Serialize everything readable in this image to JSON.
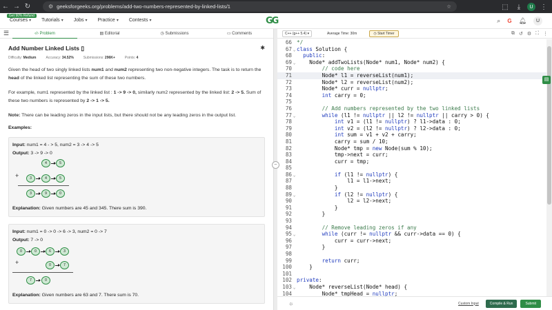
{
  "browser": {
    "url": "geeksforgeeks.org/problems/add-two-numbers-represented-by-linked-lists/1",
    "profile_initial": "U"
  },
  "header": {
    "badge": "Get 90% Refund",
    "nav": [
      "Courses",
      "Tutorials",
      "Jobs",
      "Practice",
      "Contests"
    ],
    "logo": "GG",
    "streak": "G",
    "user_initial": "U"
  },
  "left_tabs": [
    "Problem",
    "Editorial",
    "Submissions",
    "Comments"
  ],
  "problem": {
    "title": "Add Number Linked Lists",
    "difficulty_label": "Difficulty:",
    "difficulty": "Medium",
    "accuracy_label": "Accuracy:",
    "accuracy": "34.52%",
    "submissions_label": "Submissions:",
    "submissions": "296K+",
    "points_label": "Points:",
    "points": "4",
    "p1_a": "Given the head of two singly linked lists ",
    "p1_b": "num1",
    "p1_c": " and ",
    "p1_d": "num2",
    "p1_e": " representing two non-negative integers. The task is to return the ",
    "p1_f": "head",
    "p1_g": " of the linked list representing the sum of these two numbers.",
    "p2_a": "For example, num1 represented by the linked list : ",
    "p2_b": "1 -> 9 -> 0,",
    "p2_c": " similarly num2 represented by the linked list: ",
    "p2_d": "2 -> 5.",
    "p2_e": " Sum of these two numbers is represented by ",
    "p2_f": "2 -> 1 -> 5.",
    "note_label": "Note:",
    "note": " There can be leading zeros in the input lists, but there should not be any leading zeros in the output list.",
    "examples_label": "Examples:"
  },
  "example1": {
    "input_label": "Input:",
    "input": " num1 = 4 - > 5, num2 = 3 -> 4 -> 5",
    "output_label": "Output:",
    "output": "  3 -> 9 -> 0",
    "row1": [
      "4",
      "5"
    ],
    "row2": [
      "3",
      "4",
      "5"
    ],
    "row3": [
      "3",
      "9",
      "0"
    ],
    "plus": "+",
    "explanation_label": "Explanation:",
    "explanation": " Given numbers are 45 and 345. There sum is 390."
  },
  "example2": {
    "input_label": "Input:",
    "input": " num1 = 0 -> 0 -> 6 -> 3, num2 = 0 -> 7",
    "output_label": "Output:",
    "output": " 7 -> 0",
    "row1": [
      "0",
      "0",
      "6",
      "3"
    ],
    "row2": [
      "0",
      "7"
    ],
    "row3": [
      "7",
      "0"
    ],
    "plus": "+",
    "explanation_label": "Explanation:",
    "explanation": " Given numbers are 63 and 7. There sum is 70."
  },
  "editor_bar": {
    "language": "C++ (g++ 5.4)",
    "avg_time": "Average Time: 30m",
    "timer": "Start Timer"
  },
  "code_lines": [
    {
      "n": "66",
      "f": "",
      "t": "*/",
      "c": "cm"
    },
    {
      "n": "67",
      "f": "v",
      "t": "class Solution {",
      "c": ""
    },
    {
      "n": "68",
      "f": "",
      "t": "  public:",
      "c": ""
    },
    {
      "n": "69",
      "f": "v",
      "t": "    Node* addTwoLists(Node* num1, Node* num2) {",
      "c": ""
    },
    {
      "n": "70",
      "f": "",
      "t": "        // code here",
      "c": "cm"
    },
    {
      "n": "71",
      "f": "",
      "t": "        Node* l1 = reverseList(num1);",
      "c": "",
      "hl": true
    },
    {
      "n": "72",
      "f": "",
      "t": "        Node* l2 = reverseList(num2);",
      "c": ""
    },
    {
      "n": "73",
      "f": "",
      "t": "        Node* curr = nullptr;",
      "c": ""
    },
    {
      "n": "74",
      "f": "",
      "t": "        int carry = 0;",
      "c": ""
    },
    {
      "n": "75",
      "f": "",
      "t": "",
      "c": ""
    },
    {
      "n": "76",
      "f": "",
      "t": "        // Add numbers represented by the two linked lists",
      "c": "cm"
    },
    {
      "n": "77",
      "f": "v",
      "t": "        while (l1 != nullptr || l2 != nullptr || carry > 0) {",
      "c": ""
    },
    {
      "n": "78",
      "f": "",
      "t": "            int v1 = (l1 != nullptr) ? l1->data : 0;",
      "c": ""
    },
    {
      "n": "79",
      "f": "",
      "t": "            int v2 = (l2 != nullptr) ? l2->data : 0;",
      "c": ""
    },
    {
      "n": "80",
      "f": "",
      "t": "            int sum = v1 + v2 + carry;",
      "c": ""
    },
    {
      "n": "81",
      "f": "",
      "t": "            carry = sum / 10;",
      "c": ""
    },
    {
      "n": "82",
      "f": "",
      "t": "            Node* tmp = new Node(sum % 10);",
      "c": ""
    },
    {
      "n": "83",
      "f": "",
      "t": "            tmp->next = curr;",
      "c": ""
    },
    {
      "n": "84",
      "f": "",
      "t": "            curr = tmp;",
      "c": ""
    },
    {
      "n": "85",
      "f": "",
      "t": "",
      "c": ""
    },
    {
      "n": "86",
      "f": "v",
      "t": "            if (l1 != nullptr) {",
      "c": ""
    },
    {
      "n": "87",
      "f": "",
      "t": "                l1 = l1->next;",
      "c": ""
    },
    {
      "n": "88",
      "f": "",
      "t": "            }",
      "c": ""
    },
    {
      "n": "89",
      "f": "v",
      "t": "            if (l2 != nullptr) {",
      "c": ""
    },
    {
      "n": "90",
      "f": "",
      "t": "                l2 = l2->next;",
      "c": ""
    },
    {
      "n": "91",
      "f": "",
      "t": "            }",
      "c": ""
    },
    {
      "n": "92",
      "f": "",
      "t": "        }",
      "c": ""
    },
    {
      "n": "93",
      "f": "",
      "t": "",
      "c": ""
    },
    {
      "n": "94",
      "f": "",
      "t": "        // Remove leading zeros if any",
      "c": "cm"
    },
    {
      "n": "95",
      "f": "v",
      "t": "        while (curr != nullptr && curr->data == 0) {",
      "c": ""
    },
    {
      "n": "96",
      "f": "",
      "t": "            curr = curr->next;",
      "c": ""
    },
    {
      "n": "97",
      "f": "",
      "t": "        }",
      "c": ""
    },
    {
      "n": "98",
      "f": "",
      "t": "",
      "c": ""
    },
    {
      "n": "99",
      "f": "",
      "t": "        return curr;",
      "c": ""
    },
    {
      "n": "100",
      "f": "",
      "t": "    }",
      "c": ""
    },
    {
      "n": "101",
      "f": "",
      "t": "",
      "c": ""
    },
    {
      "n": "102",
      "f": "",
      "t": "private:",
      "c": ""
    },
    {
      "n": "103",
      "f": "v",
      "t": "    Node* reverseList(Node* head) {",
      "c": ""
    },
    {
      "n": "104",
      "f": "",
      "t": "        Node* tmpHead = nullptr;",
      "c": ""
    }
  ],
  "bottom": {
    "custom_input": "Custom Input",
    "compile": "Compile & Run",
    "submit": "Submit"
  }
}
